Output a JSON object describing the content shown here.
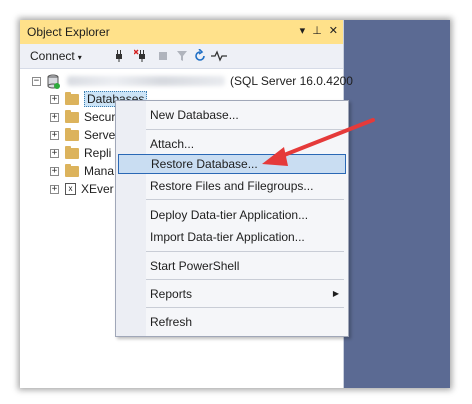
{
  "window": {
    "title": "Object Explorer",
    "controls": {
      "dropdown": "▾",
      "pin": "⊥",
      "close": "✕"
    }
  },
  "toolbar": {
    "connect_label": "Connect",
    "connect_caret": "▾"
  },
  "tree": {
    "server_suffix": "(SQL Server 16.0.4200",
    "items": [
      {
        "label": "Databases",
        "selected": true
      },
      {
        "label": "Secur"
      },
      {
        "label": "Serve"
      },
      {
        "label": "Repli"
      },
      {
        "label": "Mana"
      },
      {
        "label": "XEver"
      }
    ]
  },
  "context_menu": {
    "items": [
      {
        "label": "New Database..."
      },
      {
        "label": "Attach..."
      },
      {
        "label": "Restore Database...",
        "highlighted": true
      },
      {
        "label": "Restore Files and Filegroups..."
      },
      {
        "label": "Deploy Data-tier Application..."
      },
      {
        "label": "Import Data-tier Application..."
      },
      {
        "label": "Start PowerShell"
      },
      {
        "label": "Reports",
        "submenu_arrow": "▶"
      },
      {
        "label": "Refresh"
      }
    ]
  },
  "colors": {
    "titlebar": "#ffe18a",
    "background_pane": "#5b6a93",
    "annotation_arrow": "#e53a3a",
    "menu_highlight": "#c9ddf2"
  }
}
